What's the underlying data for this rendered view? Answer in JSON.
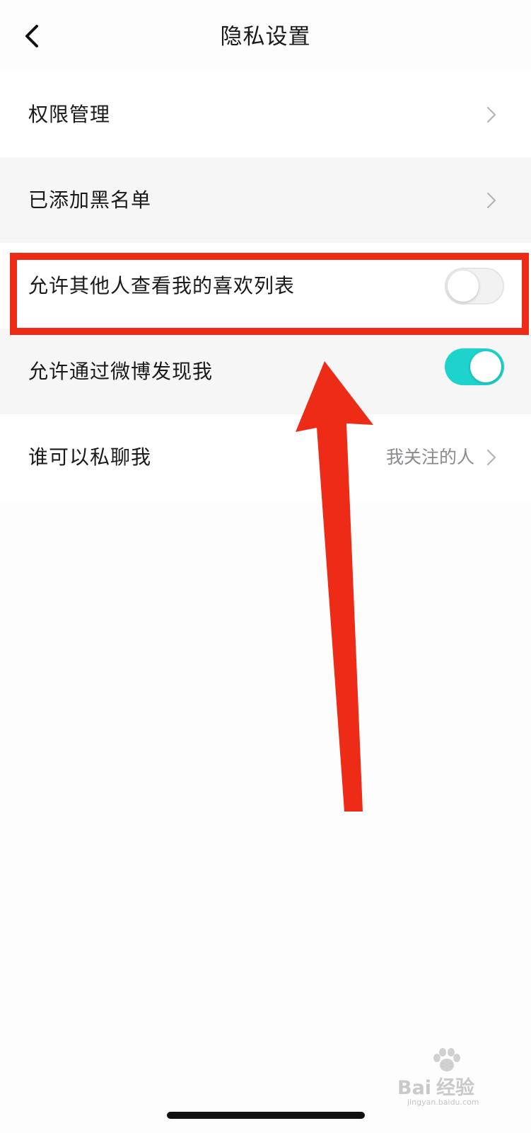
{
  "header": {
    "title": "隐私设置",
    "back_icon": "chevron-left-icon"
  },
  "settings": {
    "items": [
      {
        "label": "权限管理",
        "type": "link",
        "icon": "chevron-right-icon"
      },
      {
        "label": "已添加黑名单",
        "type": "link",
        "icon": "chevron-right-icon"
      },
      {
        "label": "允许其他人查看我的喜欢列表",
        "type": "toggle",
        "toggle_on": false
      },
      {
        "label": "允许通过微博发现我",
        "type": "toggle",
        "toggle_on": true
      },
      {
        "label": "谁可以私聊我",
        "type": "select",
        "value": "我关注的人",
        "icon": "chevron-right-icon"
      }
    ]
  },
  "annotation": {
    "highlight_color": "#ee2b16",
    "arrow_color": "#ee2b16"
  },
  "colors": {
    "toggle_on": "#1fd3cd",
    "toggle_off": "#f2f2f3",
    "page_background": "#fdfdfd",
    "row_alt_background": "#f6f6f7"
  },
  "watermark": {
    "brand": "Bai",
    "brand_suffix": "经验",
    "url": "jingyan.baidu.com"
  }
}
